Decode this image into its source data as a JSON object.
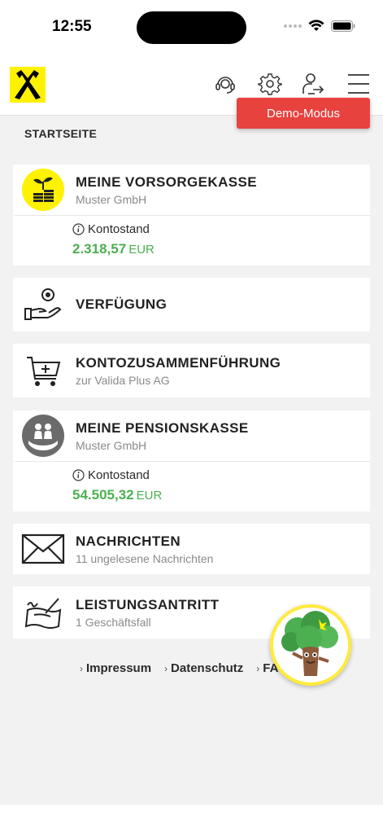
{
  "status_bar": {
    "time": "12:55"
  },
  "header": {
    "demo_label": "Demo-Modus"
  },
  "page": {
    "title": "STARTSEITE"
  },
  "cards": {
    "vorsorgekasse": {
      "title": "MEINE VORSORGEKASSE",
      "subtitle": "Muster GmbH",
      "balance_label": "Kontostand",
      "balance_amount": "2.318,57",
      "currency": "EUR"
    },
    "verfuegung": {
      "title": "VERFÜGUNG"
    },
    "kontozusammenfuehrung": {
      "title": "KONTOZUSAMMENFÜHRUNG",
      "subtitle": "zur Valida Plus AG"
    },
    "pensionskasse": {
      "title": "MEINE PENSIONSKASSE",
      "subtitle": "Muster GmbH",
      "balance_label": "Kontostand",
      "balance_amount": "54.505,32",
      "currency": "EUR"
    },
    "nachrichten": {
      "title": "NACHRICHTEN",
      "subtitle": "11 ungelesene Nachrichten"
    },
    "leistungsantritt": {
      "title": "LEISTUNGSANTRITT",
      "subtitle": "1 Geschäftsfall"
    }
  },
  "footer": {
    "links": [
      "Impressum",
      "Datenschutz",
      "FAQ"
    ]
  },
  "colors": {
    "accent_red": "#e8423f",
    "amount_green": "#4caf50",
    "brand_yellow": "#fff200"
  }
}
